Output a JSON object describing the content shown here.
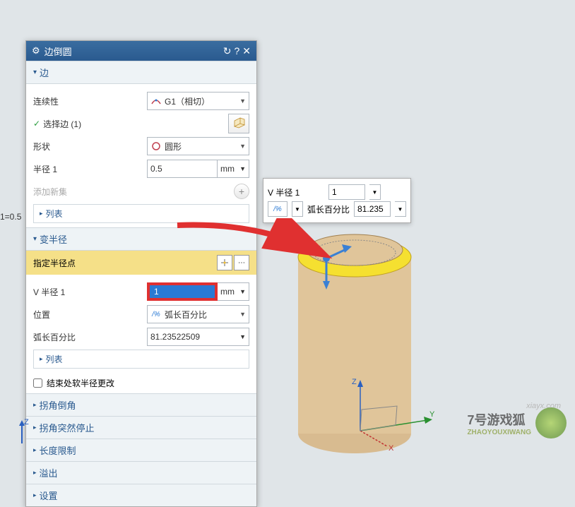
{
  "dialog": {
    "title": "边倒圆",
    "sections": {
      "edge": {
        "title": "边",
        "continuity_label": "连续性",
        "continuity_value": "G1（相切）",
        "select_edge": "选择边 (1)",
        "shape_label": "形状",
        "shape_value": "圆形",
        "radius1_label": "半径 1",
        "radius1_value": "0.5",
        "radius1_unit": "mm",
        "add_new_set": "添加新集",
        "list": "列表"
      },
      "var_radius": {
        "title": "变半径",
        "specify_point": "指定半径点",
        "v_radius1_label": "V 半径 1",
        "v_radius1_value": "1",
        "v_radius1_unit": "mm",
        "position_label": "位置",
        "position_value": "弧长百分比",
        "arc_percent_label": "弧长百分比",
        "arc_percent_value": "81.23522509",
        "list": "列表"
      },
      "soft_radius": "结束处软半径更改",
      "corner_fillet": "拐角倒角",
      "corner_stop": "拐角突然停止",
      "length_limit": "长度限制",
      "overflow": "溢出",
      "settings": "设置"
    }
  },
  "floating": {
    "v_radius_label": "V 半径 1",
    "v_radius_value": "1",
    "arc_label": "弧长百分比",
    "arc_value": "81.235",
    "percent_icon": "%"
  },
  "tooltip": "1=0.5",
  "axis": {
    "x": "X",
    "y": "Y",
    "z": "Z"
  },
  "watermark": {
    "name": "7号游戏狐",
    "sub": "ZHAOYOUXIWANG",
    "url": "xiayx.com"
  }
}
